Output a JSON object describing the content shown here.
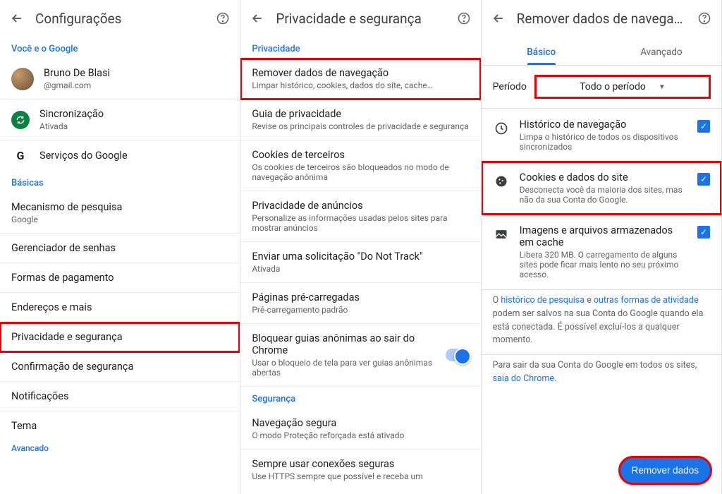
{
  "panel1": {
    "title": "Configurações",
    "sec_you": "Você e o Google",
    "user_name": "Bruno De Blasi",
    "user_email": "@gmail.com",
    "sync_title": "Sincronização",
    "sync_sub": "Ativada",
    "google_services": "Serviços do Google",
    "sec_basic": "Básicas",
    "search_engine_t": "Mecanismo de pesquisa",
    "search_engine_s": "Google",
    "passwords": "Gerenciador de senhas",
    "payments": "Formas de pagamento",
    "addresses": "Endereços e mais",
    "privacy": "Privacidade e segurança",
    "safety": "Confirmação de segurança",
    "notifications": "Notificações",
    "theme": "Tema",
    "sec_adv": "Avancado"
  },
  "panel2": {
    "title": "Privacidade e segurança",
    "sec_privacy": "Privacidade",
    "clear_t": "Remover dados de navegação",
    "clear_s": "Limpar histórico, cookies, dados do site, cache…",
    "guide_t": "Guia de privacidade",
    "guide_s": "Revise os principais controles de privacidade e segurança",
    "cookies_t": "Cookies de terceiros",
    "cookies_s": "Os cookies de terceiros são bloqueados no modo de navegação anônima",
    "ads_t": "Privacidade de anúncios",
    "ads_s": "Personalize as informações usadas pelos sites para mostrar anúncios",
    "dnt_t": "Enviar uma solicitação \"Do Not Track\"",
    "dnt_s": "Ativada",
    "preload_t": "Páginas pré-carregadas",
    "preload_s": "Pré-carregamento padrão",
    "incog_t": "Bloquear guias anônimas ao sair do Chrome",
    "incog_s": "Usar o bloqueio de tela para ver guias anônimas abertas",
    "sec_security": "Segurança",
    "safeb_t": "Navegação segura",
    "safeb_s": "O modo Proteção reforçada está ativado",
    "https_t": "Sempre usar conexões seguras",
    "https_s": "Use HTTPS sempre que possível e receba um"
  },
  "panel3": {
    "title": "Remover dados de navega…",
    "tab_basic": "Básico",
    "tab_adv": "Avançado",
    "period_label": "Período",
    "period_value": "Todo o período",
    "hist_t": "Histórico de navegação",
    "hist_s": "Limpa o histórico de todos os dispositivos sincronizados",
    "cook_t": "Cookies e dados do site",
    "cook_s": "Desconecta você da maioria dos sites, mas não da sua Conta do Google.",
    "cache_t": "Imagens e arquivos armazenados em cache",
    "cache_s": "Libera 320 MB. O carregamento de alguns sites pode ficar mais lento no seu próximo acesso.",
    "note1a": "O ",
    "note1b": "histórico de pesquisa",
    "note1c": " e ",
    "note1d": "outras formas de atividade",
    "note1e": " podem ser salvos na sua Conta do Google quando ela está conectada. É possível excluí-los a qualquer momento.",
    "note2a": "Para sair da sua Conta do Google em todos os sites, ",
    "note2b": "saia do Chrome",
    "note2c": ".",
    "btn": "Remover dados"
  }
}
